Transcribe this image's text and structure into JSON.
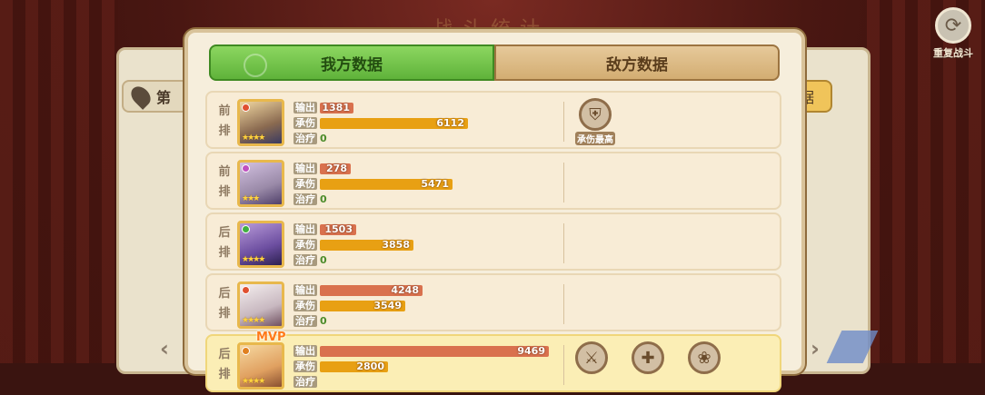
{
  "title_faded": "战斗统计",
  "replay_label": "重复战斗",
  "background": {
    "left_tab_text": "第",
    "right_button_text": "据"
  },
  "tabs": {
    "mine": "我方数据",
    "enemy": "敌方数据",
    "active": "mine"
  },
  "stat_labels": {
    "damage": "输出",
    "tank": "承伤",
    "heal": "治疗"
  },
  "max_value": 9469,
  "rows": [
    {
      "position": "前排",
      "element_color": "#e05030",
      "stars": "★★★★",
      "damage": 1381,
      "tank": 6112,
      "heal": "0",
      "mvp": false,
      "badges": [
        {
          "icon": "shield-icon",
          "label": "承伤最高"
        }
      ]
    },
    {
      "position": "前排",
      "element_color": "#c050c0",
      "stars": "★★★",
      "damage": 278,
      "tank": 5471,
      "heal": "0",
      "mvp": false,
      "badges": []
    },
    {
      "position": "后排",
      "element_color": "#40b040",
      "stars": "★★★★",
      "damage": 1503,
      "tank": 3858,
      "heal": "0",
      "mvp": false,
      "badges": []
    },
    {
      "position": "后排",
      "element_color": "#e05030",
      "stars": "★★★★",
      "damage": 4248,
      "tank": 3549,
      "heal": "0",
      "mvp": false,
      "badges": []
    },
    {
      "position": "后排",
      "element_color": "#e08020",
      "stars": "★★★★",
      "damage": 9469,
      "tank": 2800,
      "heal": "",
      "mvp": true,
      "mvp_label": "MVP",
      "badges": [
        {
          "icon": "sword-icon",
          "label": ""
        },
        {
          "icon": "heal-cross-icon",
          "label": ""
        },
        {
          "icon": "cat-icon",
          "label": ""
        }
      ]
    }
  ]
}
